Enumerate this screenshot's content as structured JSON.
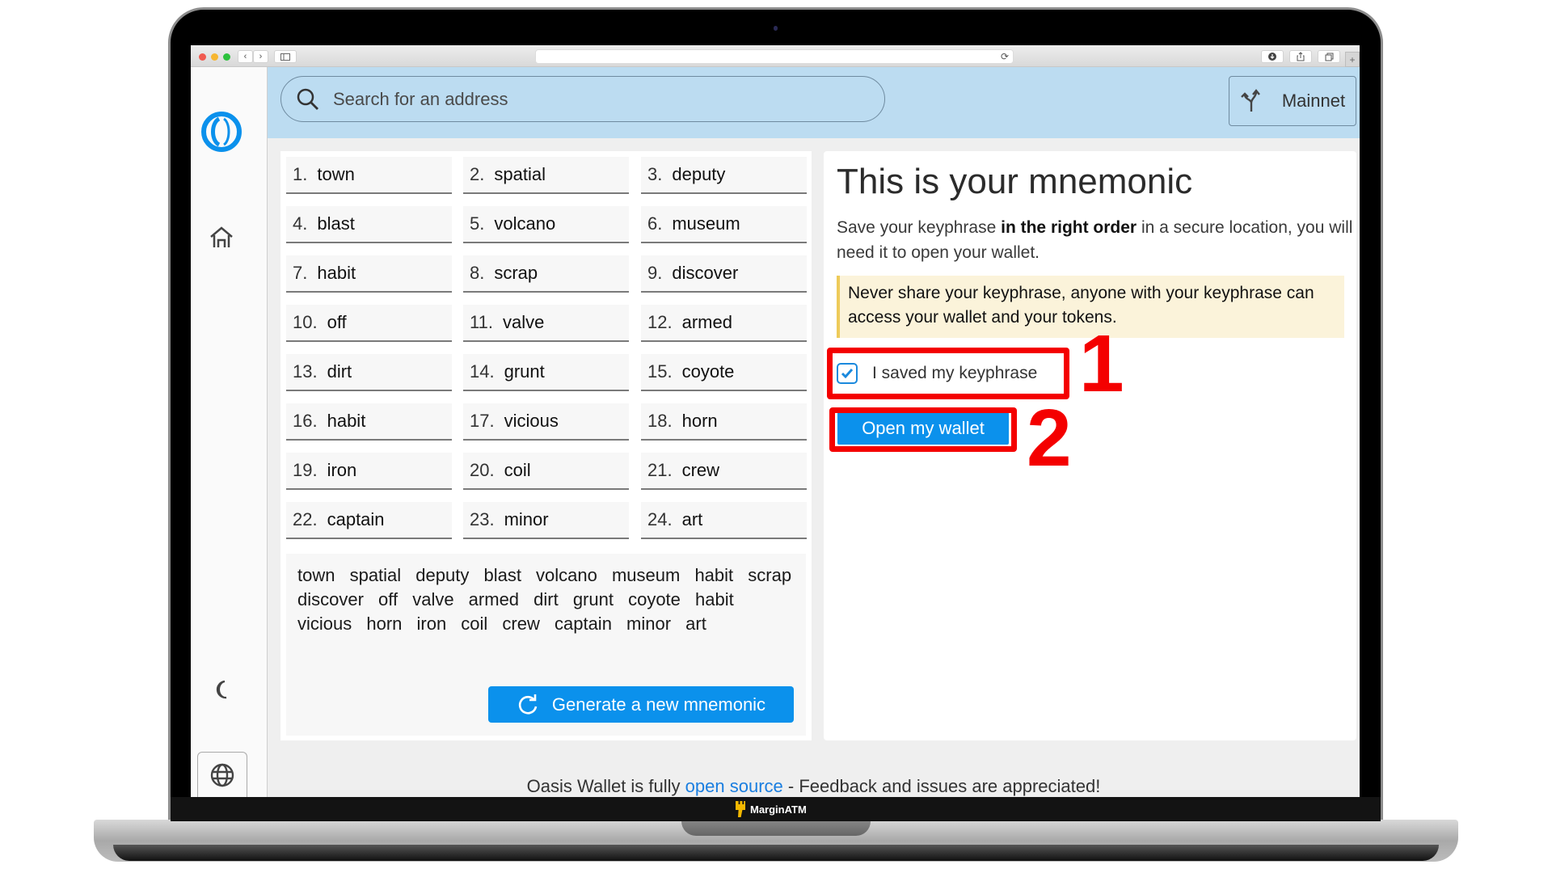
{
  "browser": {
    "reload_icon": "⟳",
    "back_icon": "‹",
    "forward_icon": "›",
    "new_tab_icon": "+"
  },
  "app": {
    "search": {
      "placeholder": "Search for an address"
    },
    "network": {
      "label": "Mainnet",
      "icon": "network-fork-icon"
    },
    "sidebar": {
      "items": [
        {
          "name": "logo",
          "icon": "oasis-logo"
        },
        {
          "name": "home",
          "icon": "home-icon"
        },
        {
          "name": "theme",
          "icon": "moon-icon"
        },
        {
          "name": "language",
          "icon": "globe-icon"
        }
      ]
    },
    "mnemonic": {
      "words": [
        {
          "n": "1.",
          "w": "town"
        },
        {
          "n": "2.",
          "w": "spatial"
        },
        {
          "n": "3.",
          "w": "deputy"
        },
        {
          "n": "4.",
          "w": "blast"
        },
        {
          "n": "5.",
          "w": "volcano"
        },
        {
          "n": "6.",
          "w": "museum"
        },
        {
          "n": "7.",
          "w": "habit"
        },
        {
          "n": "8.",
          "w": "scrap"
        },
        {
          "n": "9.",
          "w": "discover"
        },
        {
          "n": "10.",
          "w": "off"
        },
        {
          "n": "11.",
          "w": "valve"
        },
        {
          "n": "12.",
          "w": "armed"
        },
        {
          "n": "13.",
          "w": "dirt"
        },
        {
          "n": "14.",
          "w": "grunt"
        },
        {
          "n": "15.",
          "w": "coyote"
        },
        {
          "n": "16.",
          "w": "habit"
        },
        {
          "n": "17.",
          "w": "vicious"
        },
        {
          "n": "18.",
          "w": "horn"
        },
        {
          "n": "19.",
          "w": "iron"
        },
        {
          "n": "20.",
          "w": "coil"
        },
        {
          "n": "21.",
          "w": "crew"
        },
        {
          "n": "22.",
          "w": "captain"
        },
        {
          "n": "23.",
          "w": "minor"
        },
        {
          "n": "24.",
          "w": "art"
        }
      ],
      "phrase": "town spatial deputy blast volcano museum habit scrap discover off valve armed dirt grunt coyote habit vicious horn iron coil crew captain minor art",
      "generate_label": "Generate a new mnemonic"
    },
    "info": {
      "title": "This is your mnemonic",
      "desc_pre": "Save your keyphrase ",
      "desc_bold": "in the right order",
      "desc_post": " in a secure location, you will need it to open your wallet.",
      "warning": "Never share your keyphrase, anyone with your keyphrase can access your wallet and your tokens.",
      "checkbox_label": "I saved my keyphrase",
      "checkbox_checked": true,
      "open_wallet_label": "Open my wallet"
    },
    "footer": {
      "pre": "Oasis Wallet is fully ",
      "link": "open source",
      "post": " - Feedback and issues are appreciated!"
    }
  },
  "annotations": {
    "step1": "1",
    "step2": "2",
    "color": "#f40000"
  },
  "watermark": {
    "label": "MarginATM"
  },
  "colors": {
    "accent": "#0b91ec",
    "header_bg": "#bcdcf1",
    "warning_bg": "#fbf3da",
    "warning_border": "#eecb5a",
    "link": "#1a7ee0"
  }
}
